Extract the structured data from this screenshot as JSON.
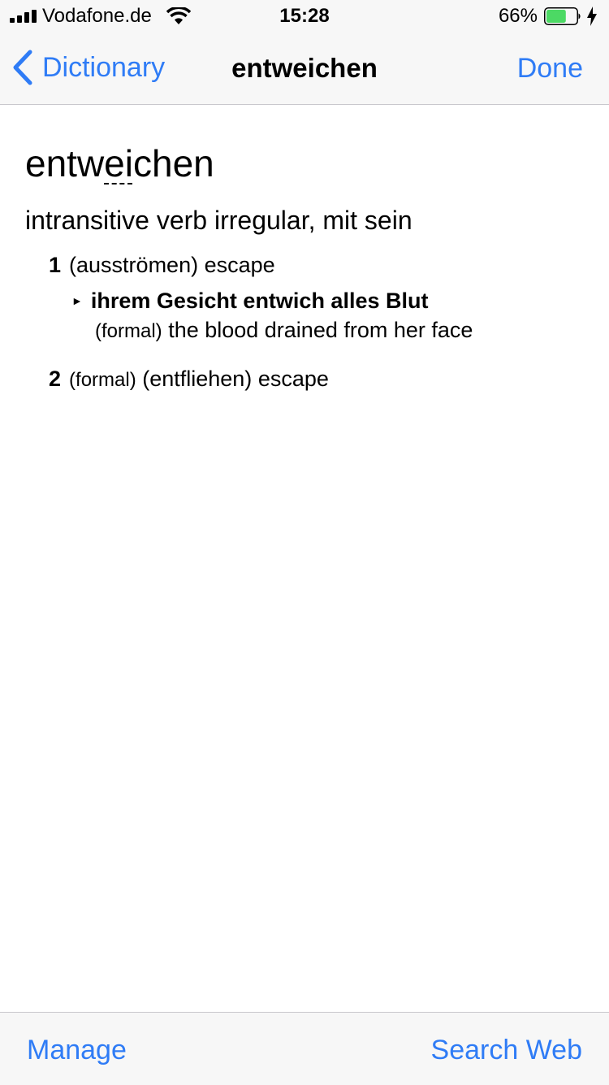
{
  "status_bar": {
    "carrier": "Vodafone.de",
    "time": "15:28",
    "battery_percent": "66%",
    "battery_level": 0.66,
    "charging": true
  },
  "nav": {
    "back_label": "Dictionary",
    "title": "entweichen",
    "done_label": "Done"
  },
  "entry": {
    "headword": {
      "before": "entw",
      "stressed": "ei",
      "after": "chen"
    },
    "part_of_speech": "intransitive verb irregular, mit sein",
    "senses": [
      {
        "number": "1",
        "context": "(ausströmen)",
        "translation": "escape",
        "example": {
          "text": "ihrem Gesicht entwich alles Blut",
          "register": "(formal)",
          "translation": "the blood drained from her face"
        }
      },
      {
        "number": "2",
        "register": "(formal)",
        "context": "(entfliehen)",
        "translation": "escape"
      }
    ]
  },
  "toolbar": {
    "manage_label": "Manage",
    "search_web_label": "Search Web"
  },
  "colors": {
    "accent": "#2f7cf6",
    "bar_background": "#f7f7f7",
    "separator": "#c8c7cc",
    "battery_fill": "#4cd964"
  },
  "icons": {
    "signal": "cellular-signal-icon",
    "wifi": "wifi-icon",
    "battery": "battery-icon",
    "charging": "charging-bolt-icon",
    "back": "chevron-left-icon",
    "example_marker": "triangle-right-icon"
  }
}
